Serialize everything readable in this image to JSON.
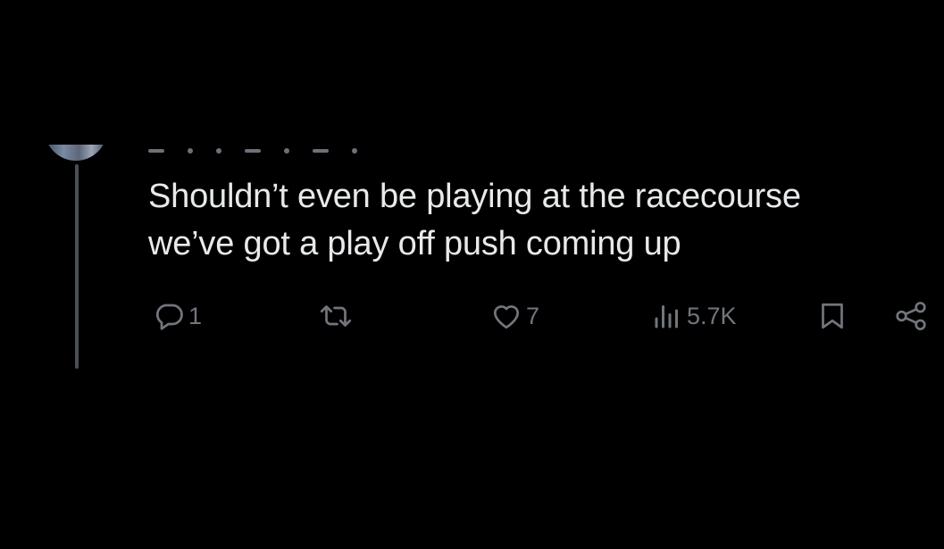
{
  "tweet": {
    "text_line1": "Shouldn’t even be playing at the racecourse",
    "text_line2": "we’ve got a play off push coming up"
  },
  "actions": {
    "reply_count": "1",
    "retweet_count": "",
    "like_count": "7",
    "views_count": "5.7K"
  },
  "icons": {
    "reply": "reply-icon",
    "retweet": "retweet-icon",
    "like": "heart-icon",
    "views": "views-icon",
    "bookmark": "bookmark-icon",
    "share": "share-icon"
  },
  "colors": {
    "background": "#000000",
    "text": "#e7e9ea",
    "muted": "#71767b",
    "thread_line": "#4a4f55",
    "accent": "#1d9bf0"
  }
}
